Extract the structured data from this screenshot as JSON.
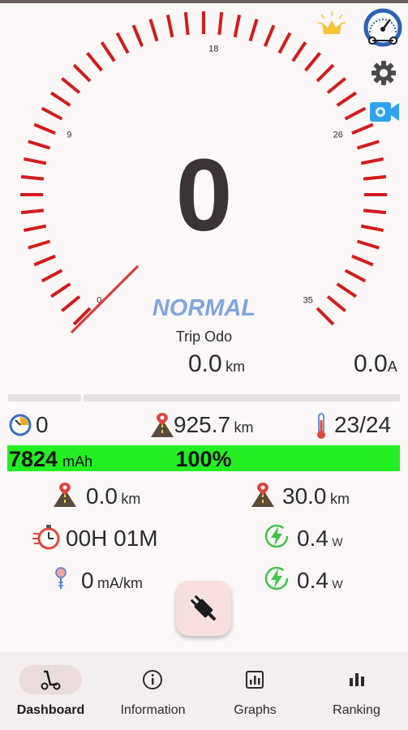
{
  "gauge": {
    "tick_labels": [
      "0",
      "9",
      "18",
      "26",
      "35"
    ],
    "max": 35,
    "needle_value": 0,
    "tick_color": "#d41b1b"
  },
  "speed": "0",
  "mode": "NORMAL",
  "trip": {
    "label": "Trip Odo",
    "value": "0.0",
    "unit": "km",
    "current_value": "0.0",
    "current_unit": "A"
  },
  "stats": {
    "speed_icon_value": "0",
    "odometer_value": "925.7",
    "odometer_unit": "km",
    "temperature": "23/24"
  },
  "battery": {
    "mah": "7824",
    "mah_unit": "mAh",
    "percent": "100%",
    "level": 1.0,
    "color": "#22ee22"
  },
  "rows": {
    "distance_left": "0.0",
    "distance_left_unit": "km",
    "distance_right": "30.0",
    "distance_right_unit": "km",
    "time": "00H 01M",
    "power1": "0.4",
    "power1_unit": "W",
    "consumption": "0",
    "consumption_unit": "mA/km",
    "power2": "0.4",
    "power2_unit": "W"
  },
  "nav": {
    "items": [
      {
        "label": "Dashboard",
        "icon": "scooter-icon",
        "active": true
      },
      {
        "label": "Information",
        "icon": "info-icon"
      },
      {
        "label": "Graphs",
        "icon": "graph-icon"
      },
      {
        "label": "Ranking",
        "icon": "bar-chart-icon"
      }
    ]
  },
  "icons": {
    "crown": "crown-icon",
    "scooter_speedo": "scooter-speedometer-icon",
    "settings": "gear-icon",
    "camera": "video-camera-icon",
    "plug": "plug-icon"
  },
  "colors": {
    "accent_blue": "#7ea6e0",
    "battery_green": "#22ee22",
    "gauge_red": "#d41b1b"
  }
}
